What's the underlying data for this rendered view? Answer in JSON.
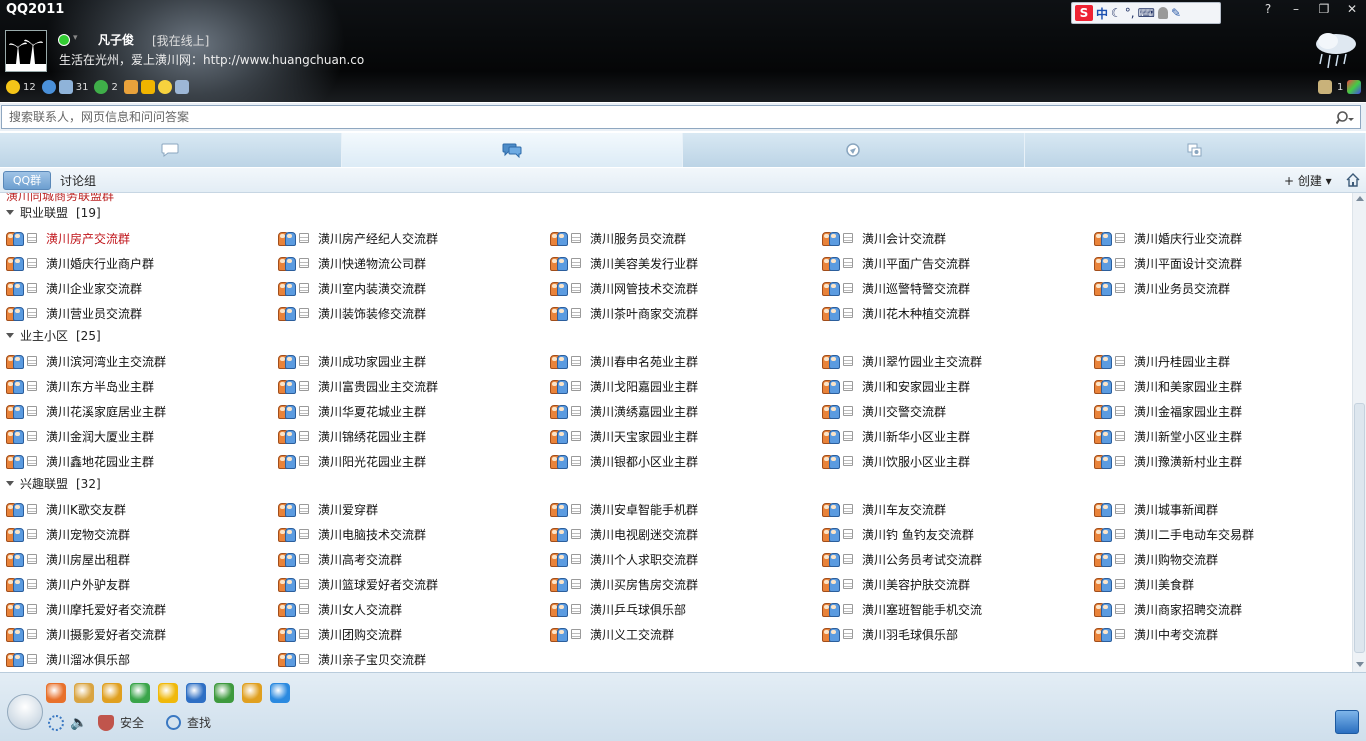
{
  "window": {
    "title": "QQ2011",
    "controls": [
      "?",
      "–",
      "❐",
      "✕"
    ]
  },
  "profile": {
    "nickname": "凡子俊",
    "status": "[我在线上]",
    "signature": "生活在光州，爱上潢川网：http://www.huangchuan.co"
  },
  "info_bar": {
    "items": [
      {
        "icon": "star-icon",
        "count": "12",
        "color": "#f5c518"
      },
      {
        "icon": "qzone-icon",
        "count": "",
        "color": "#4a90d9"
      },
      {
        "icon": "mail-icon",
        "count": "31",
        "color": "#8fb3d9"
      },
      {
        "icon": "clover-icon",
        "count": "2",
        "color": "#3fae49"
      },
      {
        "icon": "pet-icon",
        "count": "",
        "color": "#e9a23b"
      },
      {
        "icon": "bag-icon",
        "count": "",
        "color": "#f0b400"
      },
      {
        "icon": "smile-icon",
        "count": "",
        "color": "#f7d23e"
      },
      {
        "icon": "doc-icon",
        "count": "",
        "color": "#9db7d6"
      }
    ],
    "right_count": "1"
  },
  "ime": {
    "logo": "S",
    "mode": "中",
    "items": [
      "☾",
      "°,",
      "⌨",
      "👤",
      "🔧"
    ]
  },
  "search": {
    "placeholder": "搜索联系人，网页信息和问问答案"
  },
  "tabs": [
    {
      "name": "contacts",
      "icon": "contacts-tab-icon",
      "active": false
    },
    {
      "name": "groups",
      "icon": "groups-tab-icon",
      "active": true
    },
    {
      "name": "qzone",
      "icon": "qzone-tab-icon",
      "active": false
    },
    {
      "name": "recent",
      "icon": "recent-tab-icon",
      "active": false
    }
  ],
  "sub_toolbar": {
    "qq_group_tab": "QQ群",
    "discussion_tab": "讨论组",
    "create_label": "+ 创建 ▾"
  },
  "list": {
    "top_partial": "潢川同城商务联盟群",
    "categories": [
      {
        "name": "职业联盟",
        "count": "[19]",
        "groups": [
          "潢川房产交流群",
          "潢川房产经纪人交流群",
          "潢川服务员交流群",
          "潢川会计交流群",
          "潢川婚庆行业交流群",
          "潢川婚庆行业商户群",
          "潢川快递物流公司群",
          "潢川美容美发行业群",
          "潢川平面广告交流群",
          "潢川平面设计交流群",
          "潢川企业家交流群",
          "潢川室内装潢交流群",
          "潢川网管技术交流群",
          "潢川巡警特警交流群",
          "潢川业务员交流群",
          "潢川营业员交流群",
          "潢川装饰装修交流群",
          "潢川茶叶商家交流群",
          "潢川花木种植交流群"
        ],
        "highlight_index": 0
      },
      {
        "name": "业主小区",
        "count": "[25]",
        "groups": [
          "潢川滨河湾业主交流群",
          "潢川成功家园业主群",
          "潢川春申名苑业主群",
          "潢川翠竹园业主交流群",
          "潢川丹桂园业主群",
          "潢川东方半岛业主群",
          "潢川富贵园业主交流群",
          "潢川戈阳嘉园业主群",
          "潢川和安家园业主群",
          "潢川和美家园业主群",
          "潢川花溪家庭居业主群",
          "潢川华夏花城业主群",
          "潢川潢绣嘉园业主群",
          "潢川交警交流群",
          "潢川金福家园业主群",
          "潢川金润大厦业主群",
          "潢川锦绣花园业主群",
          "潢川天宝家园业主群",
          "潢川新华小区业主群",
          "潢川新堂小区业主群",
          "潢川鑫地花园业主群",
          "潢川阳光花园业主群",
          "潢川银都小区业主群",
          "潢川饮服小区业主群",
          "潢川豫潢新村业主群"
        ],
        "highlight_index": -1
      },
      {
        "name": "兴趣联盟",
        "count": "[32]",
        "groups": [
          "潢川K歌交友群",
          "潢川爱穿群",
          "潢川安卓智能手机群",
          "潢川车友交流群",
          "潢川城事新闻群",
          "潢川宠物交流群",
          "潢川电脑技术交流群",
          "潢川电视剧迷交流群",
          "潢川钓 鱼钓友交流群",
          "潢川二手电动车交易群",
          "潢川房屋出租群",
          "潢川高考交流群",
          "潢川个人求职交流群",
          "潢川公务员考试交流群",
          "潢川购物交流群",
          "潢川户外驴友群",
          "潢川篮球爱好者交流群",
          "潢川买房售房交流群",
          "潢川美容护肤交流群",
          "潢川美食群",
          "潢川摩托爱好者交流群",
          "潢川女人交流群",
          "潢川乒乓球俱乐部",
          "潢川塞班智能手机交流",
          "潢川商家招聘交流群",
          "潢川摄影爱好者交流群",
          "潢川团购交流群",
          "潢川义工交流群",
          "潢川羽毛球俱乐部",
          "潢川中考交流群",
          "潢川溜冰俱乐部",
          "潢川亲子宝贝交流群"
        ],
        "highlight_index": -1
      }
    ]
  },
  "bottom": {
    "app_icons": [
      {
        "icon": "checklist-icon",
        "color": "#e8712c"
      },
      {
        "icon": "friends-icon",
        "color": "#d9a441"
      },
      {
        "icon": "pet-penguin-icon",
        "color": "#e0a020"
      },
      {
        "icon": "money-icon",
        "color": "#3aa54a"
      },
      {
        "icon": "music-icon",
        "color": "#f0b90b"
      },
      {
        "icon": "globe-icon",
        "color": "#2e6fc4"
      },
      {
        "icon": "shield-app-icon",
        "color": "#3e9a3e"
      },
      {
        "icon": "grid-app-icon",
        "color": "#e0a020"
      },
      {
        "icon": "browser-icon",
        "color": "#2b8ae0"
      }
    ],
    "security_label": "安全",
    "find_label": "查找"
  },
  "colors": {
    "highlight_text": "#c0141a",
    "accent_blue": "#6c9fd0"
  }
}
